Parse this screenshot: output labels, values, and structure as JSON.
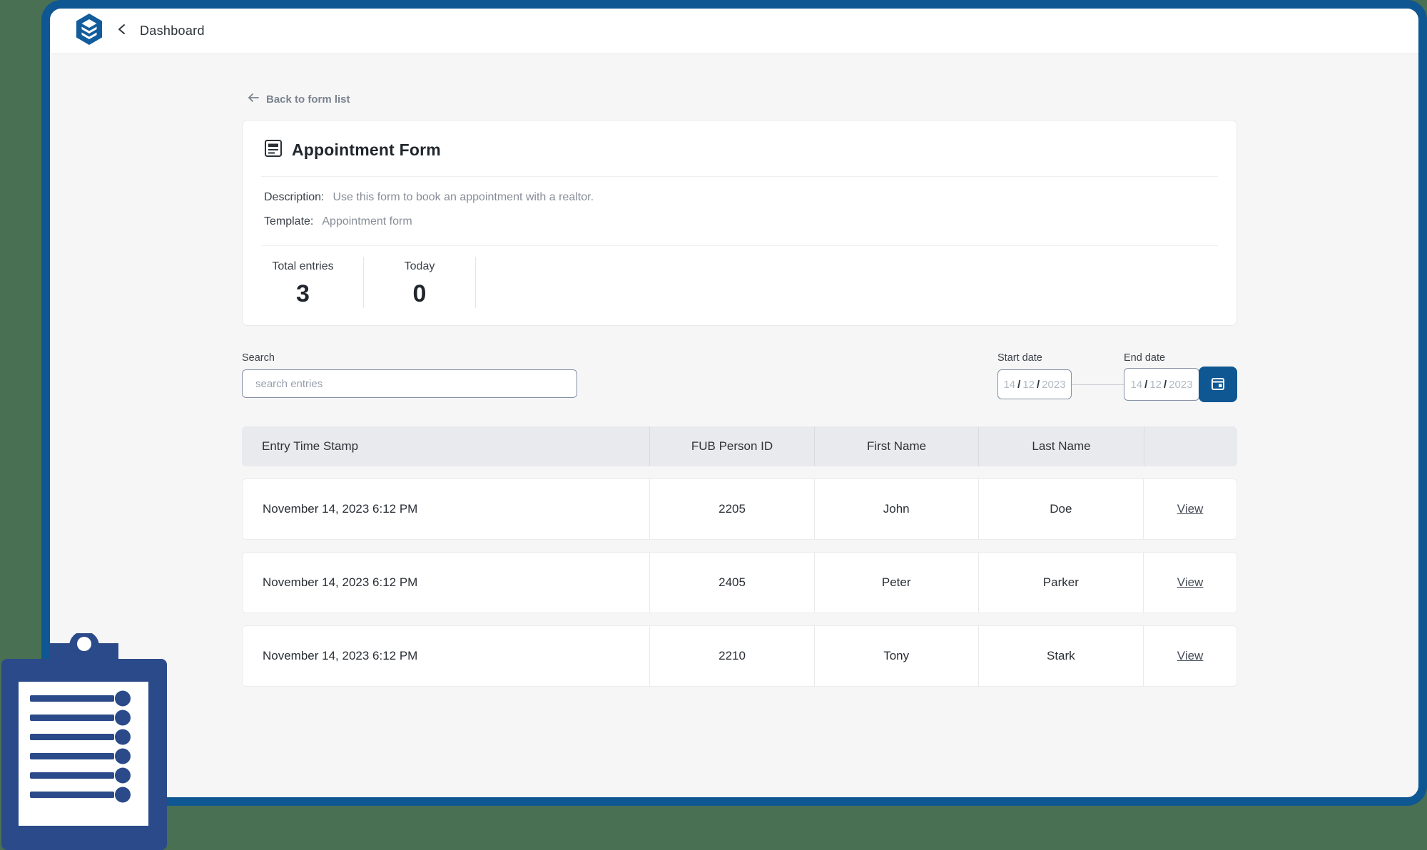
{
  "colors": {
    "frame_blue": "#0f5792",
    "background_green": "#4a7053",
    "logo_blue": "#135c9c",
    "clipboard_blue": "#2b4a89",
    "content_bg": "#f6f6f7"
  },
  "icons": {
    "logo": "layers-icon",
    "topbar_back": "chevron-left-icon",
    "back_link": "arrow-left-icon",
    "form_title": "form-icon",
    "calendar_button": "calendar-icon",
    "decoration": "clipboard-checklist-illustration"
  },
  "topbar": {
    "title": "Dashboard"
  },
  "back_link": {
    "label": "Back to form list"
  },
  "form_card": {
    "title": "Appointment Form",
    "description_label": "Description:",
    "description_value": "Use this form to book an appointment with a realtor.",
    "template_label": "Template:",
    "template_value": "Appointment form",
    "stats": [
      {
        "label": "Total entries",
        "value": "3"
      },
      {
        "label": "Today",
        "value": "0"
      }
    ]
  },
  "filters": {
    "search_label": "Search",
    "search_placeholder": "search entries",
    "start_date_label": "Start date",
    "end_date_label": "End date",
    "date_separator": "/",
    "start_date": {
      "day": "14",
      "month": "12",
      "year": "2023"
    },
    "end_date": {
      "day": "14",
      "month": "12",
      "year": "2023"
    }
  },
  "table": {
    "headers": [
      "Entry Time Stamp",
      "FUB Person ID",
      "First Name",
      "Last Name",
      ""
    ],
    "rows": [
      {
        "timestamp": "November 14, 2023 6:12 PM",
        "fub_person_id": "2205",
        "first_name": "John",
        "last_name": "Doe",
        "action": "View"
      },
      {
        "timestamp": "November 14, 2023 6:12 PM",
        "fub_person_id": "2405",
        "first_name": "Peter",
        "last_name": "Parker",
        "action": "View"
      },
      {
        "timestamp": "November 14, 2023 6:12 PM",
        "fub_person_id": "2210",
        "first_name": "Tony",
        "last_name": "Stark",
        "action": "View"
      }
    ]
  }
}
